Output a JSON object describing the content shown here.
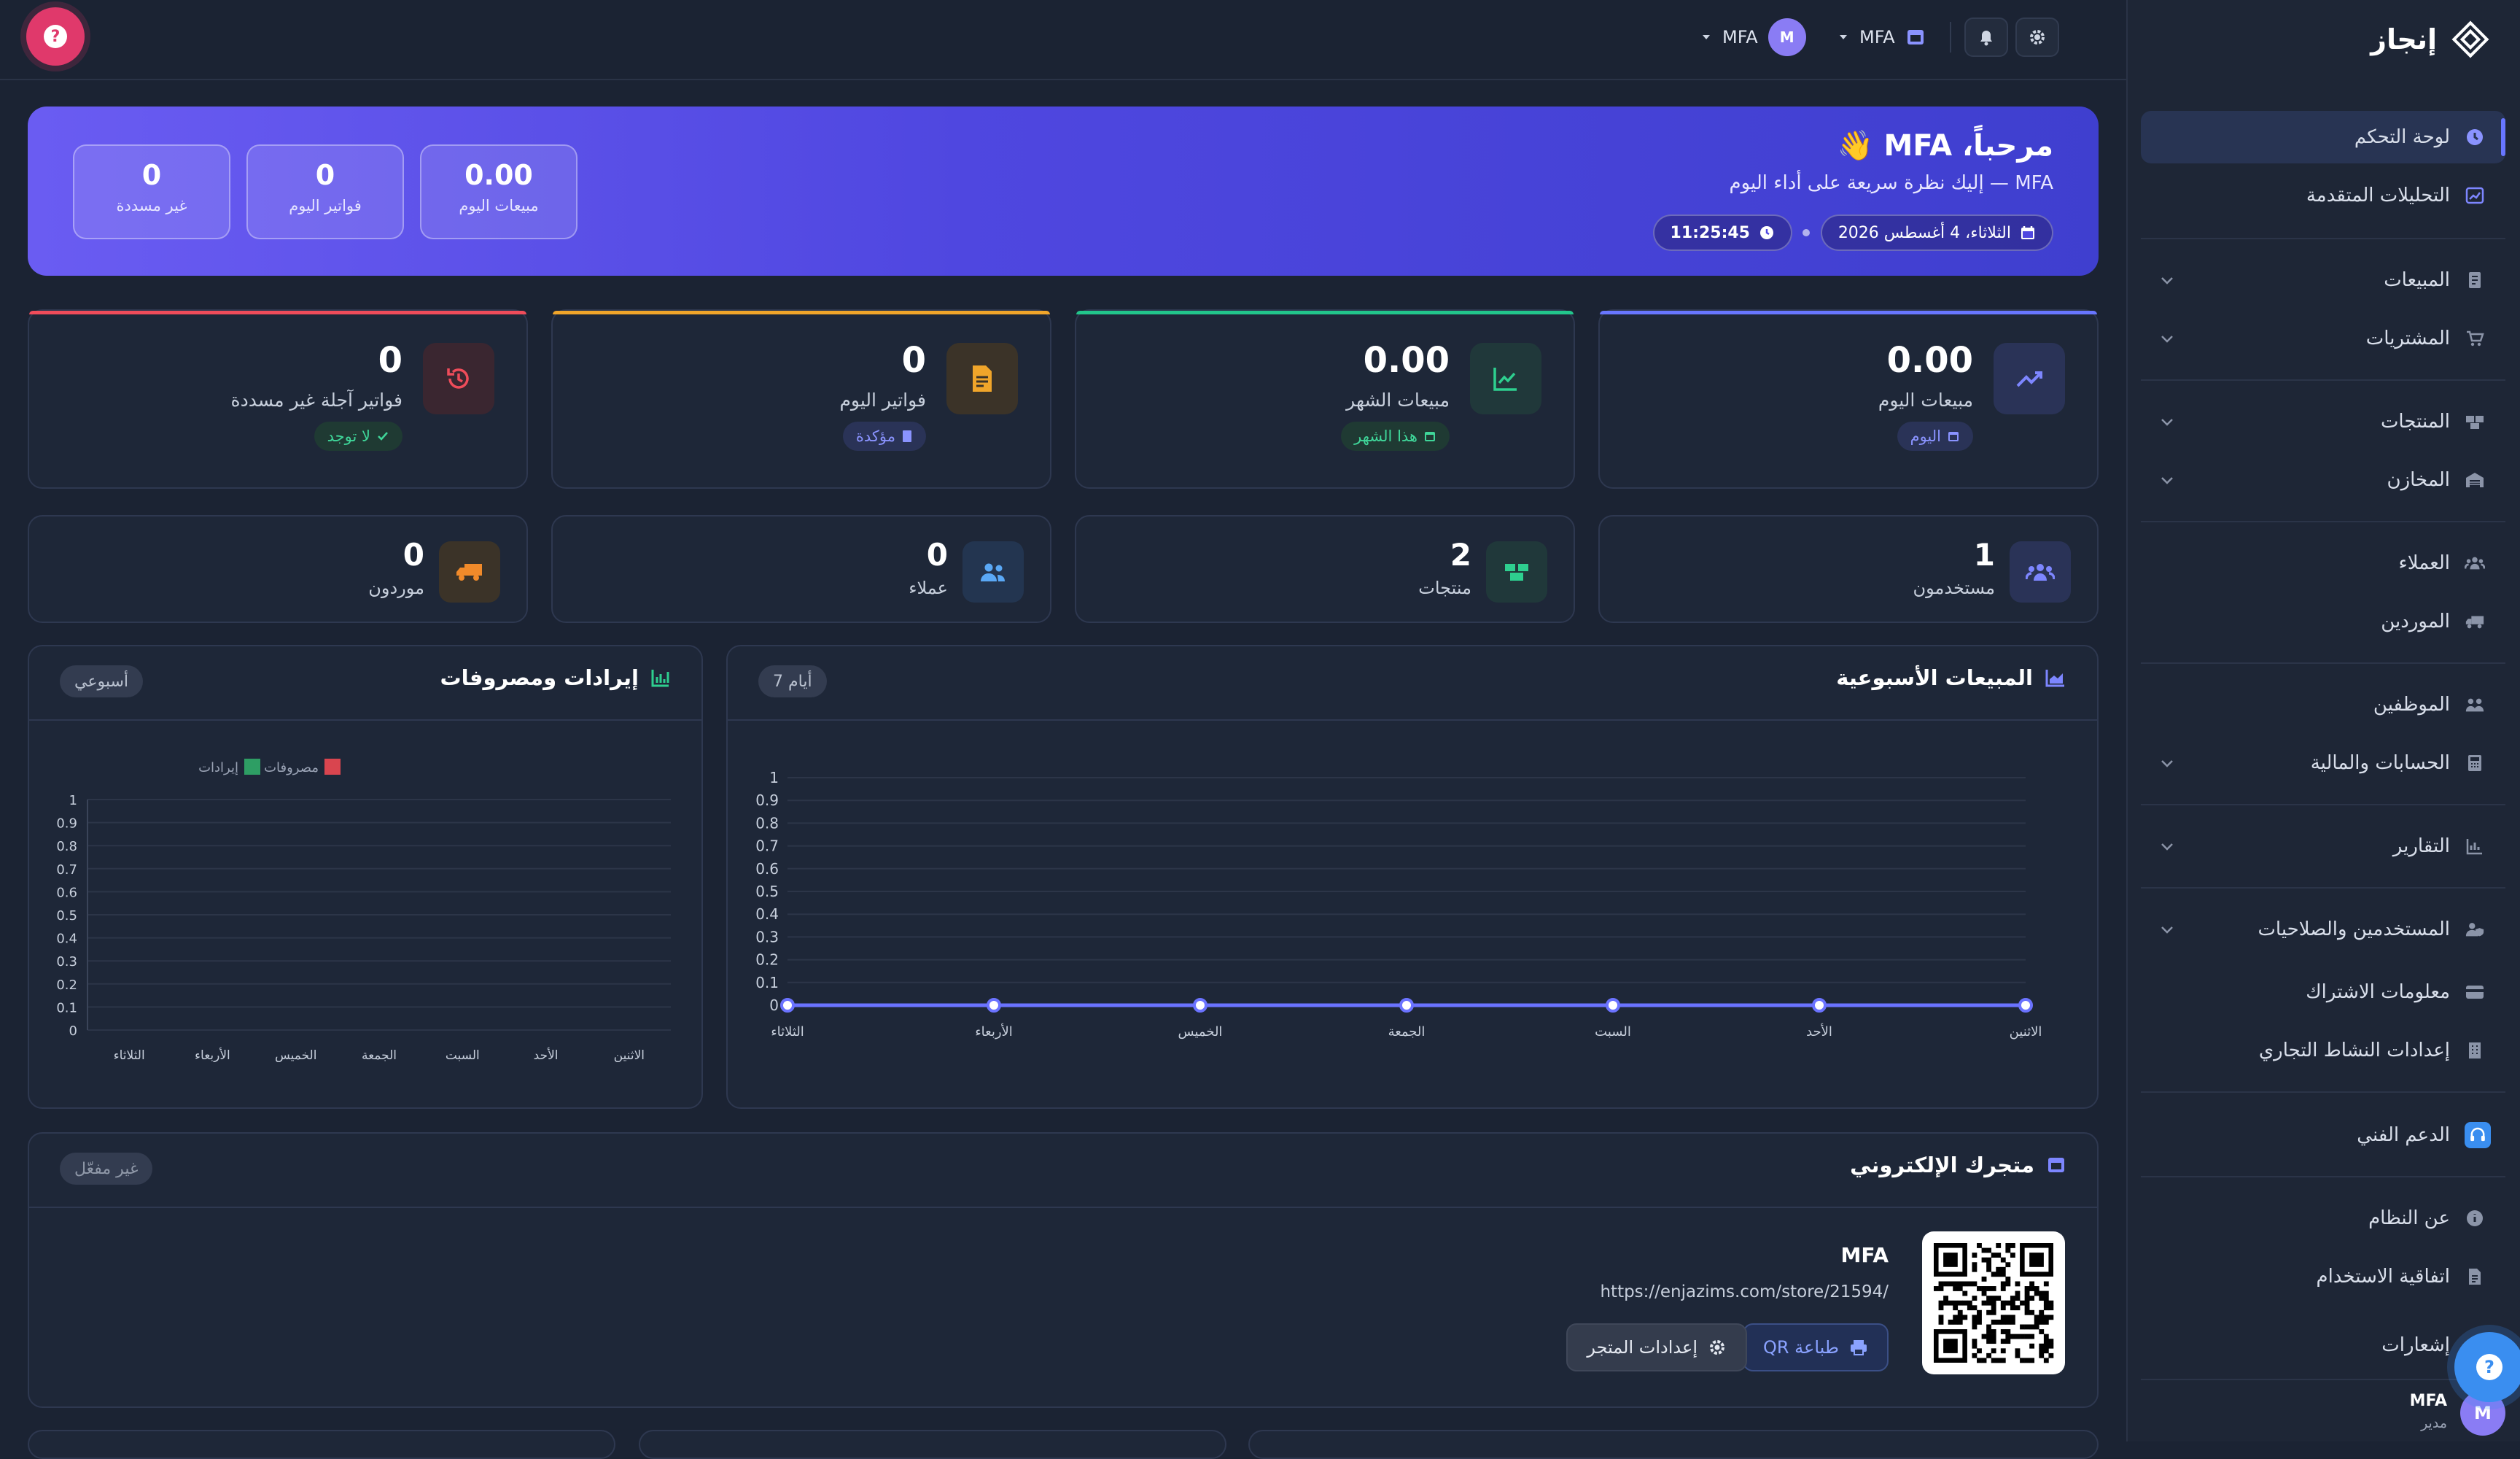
{
  "brand": {
    "name": "إنجاز"
  },
  "sidebar": {
    "items": [
      {
        "label": "لوحة التحكم",
        "icon": "dashboard-icon",
        "active": true
      },
      {
        "label": "التحليلات المتقدمة",
        "icon": "chart-line-icon"
      },
      {
        "label": "المبيعات",
        "icon": "receipt-icon",
        "expandable": true
      },
      {
        "label": "المشتريات",
        "icon": "cart-icon",
        "expandable": true
      },
      {
        "label": "المنتجات",
        "icon": "boxes-icon",
        "expandable": true
      },
      {
        "label": "المخازن",
        "icon": "warehouse-icon",
        "expandable": true
      },
      {
        "label": "العملاء",
        "icon": "users-icon"
      },
      {
        "label": "الموردين",
        "icon": "truck-icon"
      },
      {
        "label": "الموظفين",
        "icon": "team-icon"
      },
      {
        "label": "الحسابات والمالية",
        "icon": "calculator-icon",
        "expandable": true
      },
      {
        "label": "التقارير",
        "icon": "report-icon",
        "expandable": true
      },
      {
        "label": "المستخدمين والصلاحيات",
        "icon": "user-shield-icon",
        "expandable": true
      },
      {
        "label": "معلومات الاشتراك",
        "icon": "credit-card-icon"
      },
      {
        "label": "إعدادات النشاط التجاري",
        "icon": "building-icon"
      },
      {
        "label": "الدعم الفني",
        "icon": "headset-icon"
      },
      {
        "label": "عن النظام",
        "icon": "info-icon"
      },
      {
        "label": "اتفاقية الاستخدام",
        "icon": "document-icon"
      },
      {
        "label": "إشعارات",
        "icon": "bell-icon"
      }
    ],
    "user": {
      "name": "MFA",
      "role": "مدير",
      "initial": "M"
    }
  },
  "topbar": {
    "user_name": "MFA",
    "user_initial": "M",
    "store_name": "MFA"
  },
  "welcome": {
    "title": "مرحباً، MFA 👋",
    "subtitle": "MFA — إليك نظرة سريعة على أداء اليوم",
    "date": "الثلاثاء، 4 أغسطس 2026",
    "time": "11:25:45",
    "stats": [
      {
        "value": "0.00",
        "label": "مبيعات اليوم"
      },
      {
        "value": "0",
        "label": "فواتير اليوم"
      },
      {
        "value": "0",
        "label": "غير مسددة"
      }
    ]
  },
  "stat_cards": [
    {
      "value": "0.00",
      "label": "مبيعات اليوم",
      "tag": "اليوم",
      "color": "#6876ff"
    },
    {
      "value": "0.00",
      "label": "مبيعات الشهر",
      "tag": "هذا الشهر",
      "color": "#22c58b"
    },
    {
      "value": "0",
      "label": "فواتير اليوم",
      "tag": "مؤكدة",
      "color": "#f0a52a"
    },
    {
      "value": "0",
      "label": "فواتير آجلة غير مسددة",
      "tag": "لا توجد",
      "color": "#ef4c5a"
    }
  ],
  "mini_cards": [
    {
      "value": "1",
      "label": "مستخدمون"
    },
    {
      "value": "2",
      "label": "منتجات"
    },
    {
      "value": "0",
      "label": "عملاء"
    },
    {
      "value": "0",
      "label": "موردون"
    }
  ],
  "weekly_sales": {
    "title": "المبيعات الأسبوعية",
    "badge": "7 أيام"
  },
  "revenue_expenses": {
    "title": "إيرادات ومصروفات",
    "badge": "أسبوعي"
  },
  "chart_data": [
    {
      "type": "line",
      "x": [
        "الثلاثاء",
        "الأربعاء",
        "الخميس",
        "الجمعة",
        "السبت",
        "الأحد",
        "الاثنين"
      ],
      "series": [
        {
          "values": [
            0,
            0,
            0,
            0,
            0,
            0,
            0
          ],
          "color": "#6b73ff"
        }
      ],
      "yticks": [
        "0",
        "0.1",
        "0.2",
        "0.3",
        "0.4",
        "0.5",
        "0.6",
        "0.7",
        "0.8",
        "0.9",
        "1"
      ],
      "ylim": [
        0,
        1
      ],
      "grid": true
    },
    {
      "type": "bar",
      "categories": [
        "الثلاثاء",
        "الأربعاء",
        "الخميس",
        "الجمعة",
        "السبت",
        "الأحد",
        "الاثنين"
      ],
      "series": [
        {
          "name": "إيرادات",
          "values": [
            0,
            0,
            0,
            0,
            0,
            0,
            0
          ],
          "color": "#2e9e64"
        },
        {
          "name": "مصروفات",
          "values": [
            0,
            0,
            0,
            0,
            0,
            0,
            0
          ],
          "color": "#d9454f"
        }
      ],
      "yticks": [
        "0",
        "0.1",
        "0.2",
        "0.3",
        "0.4",
        "0.5",
        "0.6",
        "0.7",
        "0.8",
        "0.9",
        "1"
      ],
      "ylim": [
        0,
        1
      ],
      "legend": "top",
      "grid": true
    }
  ],
  "store": {
    "title": "متجرك الإلكتروني",
    "badge": "غير مفعّل",
    "name": "MFA",
    "url": "https://enjazims.com/store/21594/",
    "print_qr_label": "طباعة QR",
    "settings_label": "إعدادات المتجر"
  },
  "colors": {
    "accent": "#6876ff",
    "background": "#1b2333",
    "card": "#1e2738",
    "help": "#e0396b"
  }
}
